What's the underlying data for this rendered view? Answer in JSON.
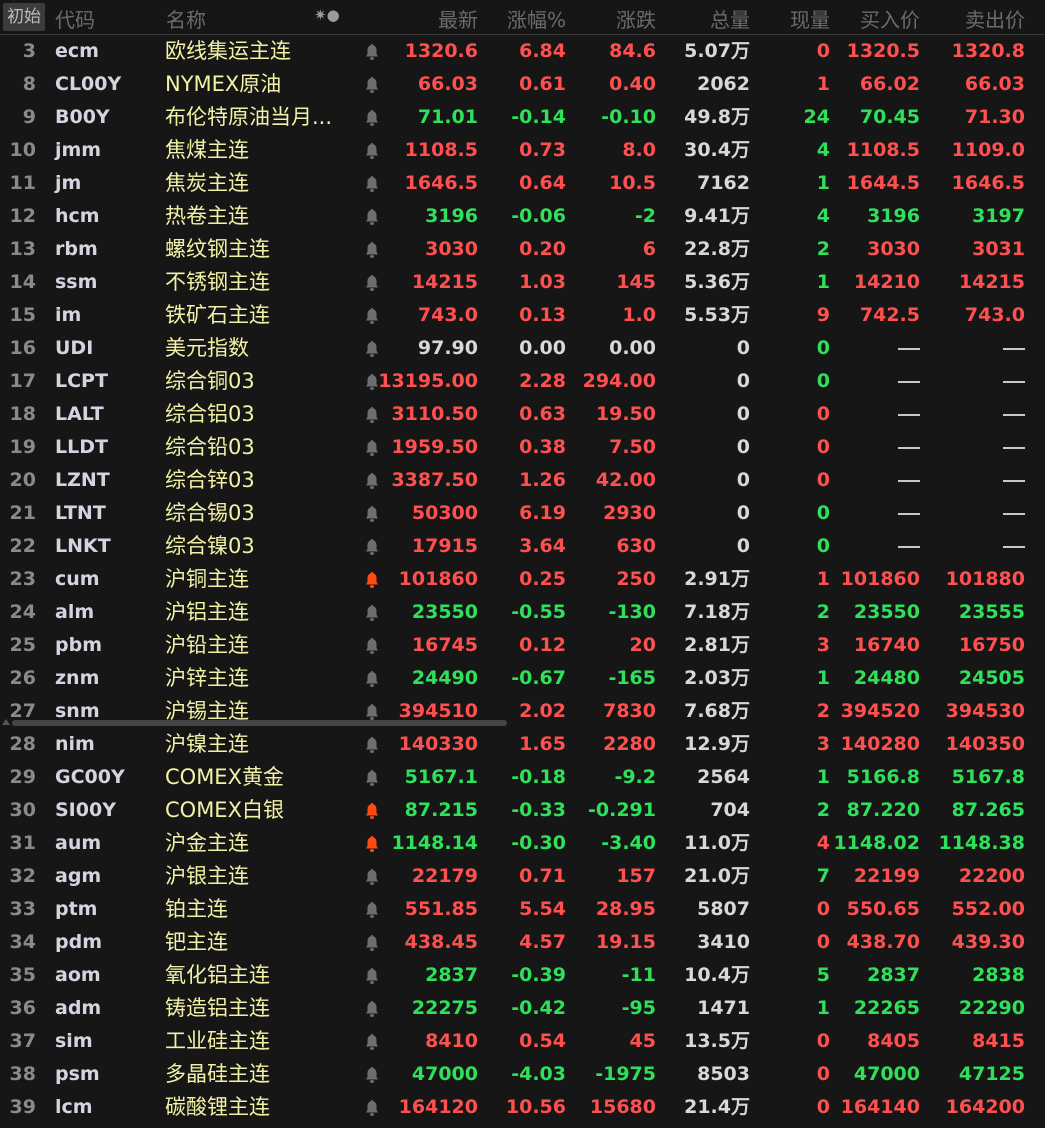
{
  "colors": {
    "up": "#ff5050",
    "down": "#2fe05a",
    "flat": "#d8d8d8",
    "bell_off": "#6e6e6e",
    "bell_on": "#ff4a12"
  },
  "header": {
    "init_button": "初始",
    "code": "代码",
    "name": "名称",
    "settings_glyph": "✷●",
    "last": "最新",
    "pct": "涨幅%",
    "chg": "涨跌",
    "vol": "总量",
    "cur": "现量",
    "bid": "买入价",
    "ask": "卖出价"
  },
  "rows": [
    {
      "i": "3",
      "code": "ecm",
      "name": "欧线集运主连",
      "last": "1320.6",
      "pct": "6.84",
      "chg": "84.6",
      "vol": "5.07万",
      "cur": "0",
      "bid": "1320.5",
      "ask": "1320.8",
      "c": "up",
      "cc": "up",
      "bc": "up",
      "ac": "up",
      "bell": false
    },
    {
      "i": "8",
      "code": "CL00Y",
      "name": "NYMEX原油",
      "last": "66.03",
      "pct": "0.61",
      "chg": "0.40",
      "vol": "2062",
      "cur": "1",
      "bid": "66.02",
      "ask": "66.03",
      "c": "up",
      "cc": "up",
      "bc": "up",
      "ac": "up",
      "bell": false
    },
    {
      "i": "9",
      "code": "B00Y",
      "name": "布伦特原油当月...",
      "last": "71.01",
      "pct": "-0.14",
      "chg": "-0.10",
      "vol": "49.8万",
      "cur": "24",
      "bid": "70.45",
      "ask": "71.30",
      "c": "down",
      "cc": "down",
      "bc": "down",
      "ac": "up",
      "bell": false
    },
    {
      "i": "10",
      "code": "jmm",
      "name": "焦煤主连",
      "last": "1108.5",
      "pct": "0.73",
      "chg": "8.0",
      "vol": "30.4万",
      "cur": "4",
      "bid": "1108.5",
      "ask": "1109.0",
      "c": "up",
      "cc": "down",
      "bc": "up",
      "ac": "up",
      "bell": false
    },
    {
      "i": "11",
      "code": "jm",
      "name": "焦炭主连",
      "last": "1646.5",
      "pct": "0.64",
      "chg": "10.5",
      "vol": "7162",
      "cur": "1",
      "bid": "1644.5",
      "ask": "1646.5",
      "c": "up",
      "cc": "down",
      "bc": "up",
      "ac": "up",
      "bell": false
    },
    {
      "i": "12",
      "code": "hcm",
      "name": "热卷主连",
      "last": "3196",
      "pct": "-0.06",
      "chg": "-2",
      "vol": "9.41万",
      "cur": "4",
      "bid": "3196",
      "ask": "3197",
      "c": "down",
      "cc": "down",
      "bc": "down",
      "ac": "down",
      "bell": false
    },
    {
      "i": "13",
      "code": "rbm",
      "name": "螺纹钢主连",
      "last": "3030",
      "pct": "0.20",
      "chg": "6",
      "vol": "22.8万",
      "cur": "2",
      "bid": "3030",
      "ask": "3031",
      "c": "up",
      "cc": "down",
      "bc": "up",
      "ac": "up",
      "bell": false
    },
    {
      "i": "14",
      "code": "ssm",
      "name": "不锈钢主连",
      "last": "14215",
      "pct": "1.03",
      "chg": "145",
      "vol": "5.36万",
      "cur": "1",
      "bid": "14210",
      "ask": "14215",
      "c": "up",
      "cc": "down",
      "bc": "up",
      "ac": "up",
      "bell": false
    },
    {
      "i": "15",
      "code": "im",
      "name": "铁矿石主连",
      "last": "743.0",
      "pct": "0.13",
      "chg": "1.0",
      "vol": "5.53万",
      "cur": "9",
      "bid": "742.5",
      "ask": "743.0",
      "c": "up",
      "cc": "up",
      "bc": "up",
      "ac": "up",
      "bell": false
    },
    {
      "i": "16",
      "code": "UDI",
      "name": "美元指数",
      "last": "97.90",
      "pct": "0.00",
      "chg": "0.00",
      "vol": "0",
      "cur": "0",
      "bid": "—",
      "ask": "—",
      "c": "flat",
      "cc": "down",
      "bc": "flat",
      "ac": "flat",
      "bell": false
    },
    {
      "i": "17",
      "code": "LCPT",
      "name": "综合铜03",
      "last": "13195.00",
      "pct": "2.28",
      "chg": "294.00",
      "vol": "0",
      "cur": "0",
      "bid": "—",
      "ask": "—",
      "c": "up",
      "cc": "down",
      "bc": "flat",
      "ac": "flat",
      "bell": false
    },
    {
      "i": "18",
      "code": "LALT",
      "name": "综合铝03",
      "last": "3110.50",
      "pct": "0.63",
      "chg": "19.50",
      "vol": "0",
      "cur": "0",
      "bid": "—",
      "ask": "—",
      "c": "up",
      "cc": "up",
      "bc": "flat",
      "ac": "flat",
      "bell": false
    },
    {
      "i": "19",
      "code": "LLDT",
      "name": "综合铅03",
      "last": "1959.50",
      "pct": "0.38",
      "chg": "7.50",
      "vol": "0",
      "cur": "0",
      "bid": "—",
      "ask": "—",
      "c": "up",
      "cc": "up",
      "bc": "flat",
      "ac": "flat",
      "bell": false
    },
    {
      "i": "20",
      "code": "LZNT",
      "name": "综合锌03",
      "last": "3387.50",
      "pct": "1.26",
      "chg": "42.00",
      "vol": "0",
      "cur": "0",
      "bid": "—",
      "ask": "—",
      "c": "up",
      "cc": "up",
      "bc": "flat",
      "ac": "flat",
      "bell": false
    },
    {
      "i": "21",
      "code": "LTNT",
      "name": "综合锡03",
      "last": "50300",
      "pct": "6.19",
      "chg": "2930",
      "vol": "0",
      "cur": "0",
      "bid": "—",
      "ask": "—",
      "c": "up",
      "cc": "down",
      "bc": "flat",
      "ac": "flat",
      "bell": false
    },
    {
      "i": "22",
      "code": "LNKT",
      "name": "综合镍03",
      "last": "17915",
      "pct": "3.64",
      "chg": "630",
      "vol": "0",
      "cur": "0",
      "bid": "—",
      "ask": "—",
      "c": "up",
      "cc": "down",
      "bc": "flat",
      "ac": "flat",
      "bell": false
    },
    {
      "i": "23",
      "code": "cum",
      "name": "沪铜主连",
      "last": "101860",
      "pct": "0.25",
      "chg": "250",
      "vol": "2.91万",
      "cur": "1",
      "bid": "101860",
      "ask": "101880",
      "c": "up",
      "cc": "up",
      "bc": "up",
      "ac": "up",
      "bell": true
    },
    {
      "i": "24",
      "code": "alm",
      "name": "沪铝主连",
      "last": "23550",
      "pct": "-0.55",
      "chg": "-130",
      "vol": "7.18万",
      "cur": "2",
      "bid": "23550",
      "ask": "23555",
      "c": "down",
      "cc": "down",
      "bc": "down",
      "ac": "down",
      "bell": false
    },
    {
      "i": "25",
      "code": "pbm",
      "name": "沪铅主连",
      "last": "16745",
      "pct": "0.12",
      "chg": "20",
      "vol": "2.81万",
      "cur": "3",
      "bid": "16740",
      "ask": "16750",
      "c": "up",
      "cc": "up",
      "bc": "up",
      "ac": "up",
      "bell": false
    },
    {
      "i": "26",
      "code": "znm",
      "name": "沪锌主连",
      "last": "24490",
      "pct": "-0.67",
      "chg": "-165",
      "vol": "2.03万",
      "cur": "1",
      "bid": "24480",
      "ask": "24505",
      "c": "down",
      "cc": "down",
      "bc": "down",
      "ac": "down",
      "bell": false
    },
    {
      "i": "27",
      "code": "snm",
      "name": "沪锡主连",
      "last": "394510",
      "pct": "2.02",
      "chg": "7830",
      "vol": "7.68万",
      "cur": "2",
      "bid": "394520",
      "ask": "394530",
      "c": "up",
      "cc": "up",
      "bc": "up",
      "ac": "up",
      "bell": false
    },
    {
      "i": "28",
      "code": "nim",
      "name": "沪镍主连",
      "last": "140330",
      "pct": "1.65",
      "chg": "2280",
      "vol": "12.9万",
      "cur": "3",
      "bid": "140280",
      "ask": "140350",
      "c": "up",
      "cc": "up",
      "bc": "up",
      "ac": "up",
      "bell": false
    },
    {
      "i": "29",
      "code": "GC00Y",
      "name": "COMEX黄金",
      "last": "5167.1",
      "pct": "-0.18",
      "chg": "-9.2",
      "vol": "2564",
      "cur": "1",
      "bid": "5166.8",
      "ask": "5167.8",
      "c": "down",
      "cc": "down",
      "bc": "down",
      "ac": "down",
      "bell": false
    },
    {
      "i": "30",
      "code": "SI00Y",
      "name": "COMEX白银",
      "last": "87.215",
      "pct": "-0.33",
      "chg": "-0.291",
      "vol": "704",
      "cur": "2",
      "bid": "87.220",
      "ask": "87.265",
      "c": "down",
      "cc": "down",
      "bc": "down",
      "ac": "down",
      "bell": true
    },
    {
      "i": "31",
      "code": "aum",
      "name": "沪金主连",
      "last": "1148.14",
      "pct": "-0.30",
      "chg": "-3.40",
      "vol": "11.0万",
      "cur": "4",
      "bid": "1148.02",
      "ask": "1148.38",
      "c": "down",
      "cc": "up",
      "bc": "down",
      "ac": "down",
      "bell": true
    },
    {
      "i": "32",
      "code": "agm",
      "name": "沪银主连",
      "last": "22179",
      "pct": "0.71",
      "chg": "157",
      "vol": "21.0万",
      "cur": "7",
      "bid": "22199",
      "ask": "22200",
      "c": "up",
      "cc": "down",
      "bc": "up",
      "ac": "up",
      "bell": false
    },
    {
      "i": "33",
      "code": "ptm",
      "name": "铂主连",
      "last": "551.85",
      "pct": "5.54",
      "chg": "28.95",
      "vol": "5807",
      "cur": "0",
      "bid": "550.65",
      "ask": "552.00",
      "c": "up",
      "cc": "up",
      "bc": "up",
      "ac": "up",
      "bell": false
    },
    {
      "i": "34",
      "code": "pdm",
      "name": "钯主连",
      "last": "438.45",
      "pct": "4.57",
      "chg": "19.15",
      "vol": "3410",
      "cur": "0",
      "bid": "438.70",
      "ask": "439.30",
      "c": "up",
      "cc": "up",
      "bc": "up",
      "ac": "up",
      "bell": false
    },
    {
      "i": "35",
      "code": "aom",
      "name": "氧化铝主连",
      "last": "2837",
      "pct": "-0.39",
      "chg": "-11",
      "vol": "10.4万",
      "cur": "5",
      "bid": "2837",
      "ask": "2838",
      "c": "down",
      "cc": "down",
      "bc": "down",
      "ac": "down",
      "bell": false
    },
    {
      "i": "36",
      "code": "adm",
      "name": "铸造铝主连",
      "last": "22275",
      "pct": "-0.42",
      "chg": "-95",
      "vol": "1471",
      "cur": "1",
      "bid": "22265",
      "ask": "22290",
      "c": "down",
      "cc": "down",
      "bc": "down",
      "ac": "down",
      "bell": false
    },
    {
      "i": "37",
      "code": "sim",
      "name": "工业硅主连",
      "last": "8410",
      "pct": "0.54",
      "chg": "45",
      "vol": "13.5万",
      "cur": "0",
      "bid": "8405",
      "ask": "8415",
      "c": "up",
      "cc": "up",
      "bc": "up",
      "ac": "up",
      "bell": false
    },
    {
      "i": "38",
      "code": "psm",
      "name": "多晶硅主连",
      "last": "47000",
      "pct": "-4.03",
      "chg": "-1975",
      "vol": "8503",
      "cur": "0",
      "bid": "47000",
      "ask": "47125",
      "c": "down",
      "cc": "up",
      "bc": "down",
      "ac": "down",
      "bell": false
    },
    {
      "i": "39",
      "code": "lcm",
      "name": "碳酸锂主连",
      "last": "164120",
      "pct": "10.56",
      "chg": "15680",
      "vol": "21.4万",
      "cur": "0",
      "bid": "164140",
      "ask": "164200",
      "c": "up",
      "cc": "up",
      "bc": "up",
      "ac": "up",
      "bell": false
    }
  ]
}
